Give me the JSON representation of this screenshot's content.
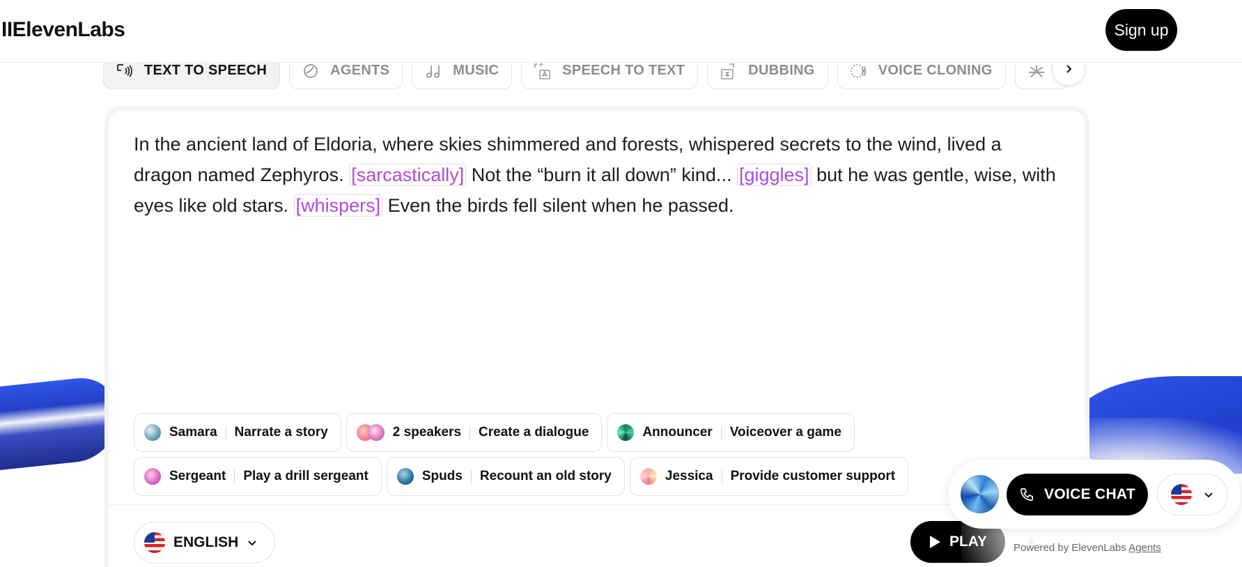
{
  "header": {
    "logo": "IIElevenLabs",
    "signup_label": "Sign up"
  },
  "tabs": [
    {
      "label": "TEXT TO SPEECH",
      "icon": "text-to-speech-icon",
      "active": true
    },
    {
      "label": "AGENTS",
      "icon": "agents-icon",
      "active": false
    },
    {
      "label": "MUSIC",
      "icon": "music-note-icon",
      "active": false
    },
    {
      "label": "SPEECH TO TEXT",
      "icon": "speech-to-text-icon",
      "active": false
    },
    {
      "label": "DUBBING",
      "icon": "dubbing-icon",
      "active": false
    },
    {
      "label": "VOICE CLONING",
      "icon": "voice-cloning-icon",
      "active": false
    }
  ],
  "editor": {
    "p1": "In the ancient land of Eldoria, where skies shimmered and forests, whispered secrets to the wind, lived a dragon named Zephyros.",
    "tag1": "[sarcastically]",
    "p2": "Not the “burn it all down” kind...",
    "tag2": "[giggles]",
    "p3": "but he was gentle, wise, with eyes like old stars.",
    "tag3": "[whispers]",
    "p4": "Even the birds fell silent when he passed."
  },
  "presets": {
    "row1": [
      {
        "voice": "Samara",
        "task": "Narrate a story"
      },
      {
        "voice": "2 speakers",
        "task": "Create a dialogue"
      },
      {
        "voice": "Announcer",
        "task": "Voiceover a game"
      }
    ],
    "row2": [
      {
        "voice": "Sergeant",
        "task": "Play a drill sergeant"
      },
      {
        "voice": "Spuds",
        "task": "Recount an old story"
      },
      {
        "voice": "Jessica",
        "task": "Provide customer support"
      }
    ]
  },
  "language": {
    "selected": "ENGLISH"
  },
  "player": {
    "play_label": "PLAY"
  },
  "voice_chat": {
    "button_label": "VOICE CHAT",
    "powered_prefix": "Powered by ElevenLabs",
    "powered_link": "Agents"
  },
  "colors": {
    "accent_tag": "#b04ad6",
    "primary_button": "#000000",
    "ribbon_blue": "#2f56e8"
  }
}
